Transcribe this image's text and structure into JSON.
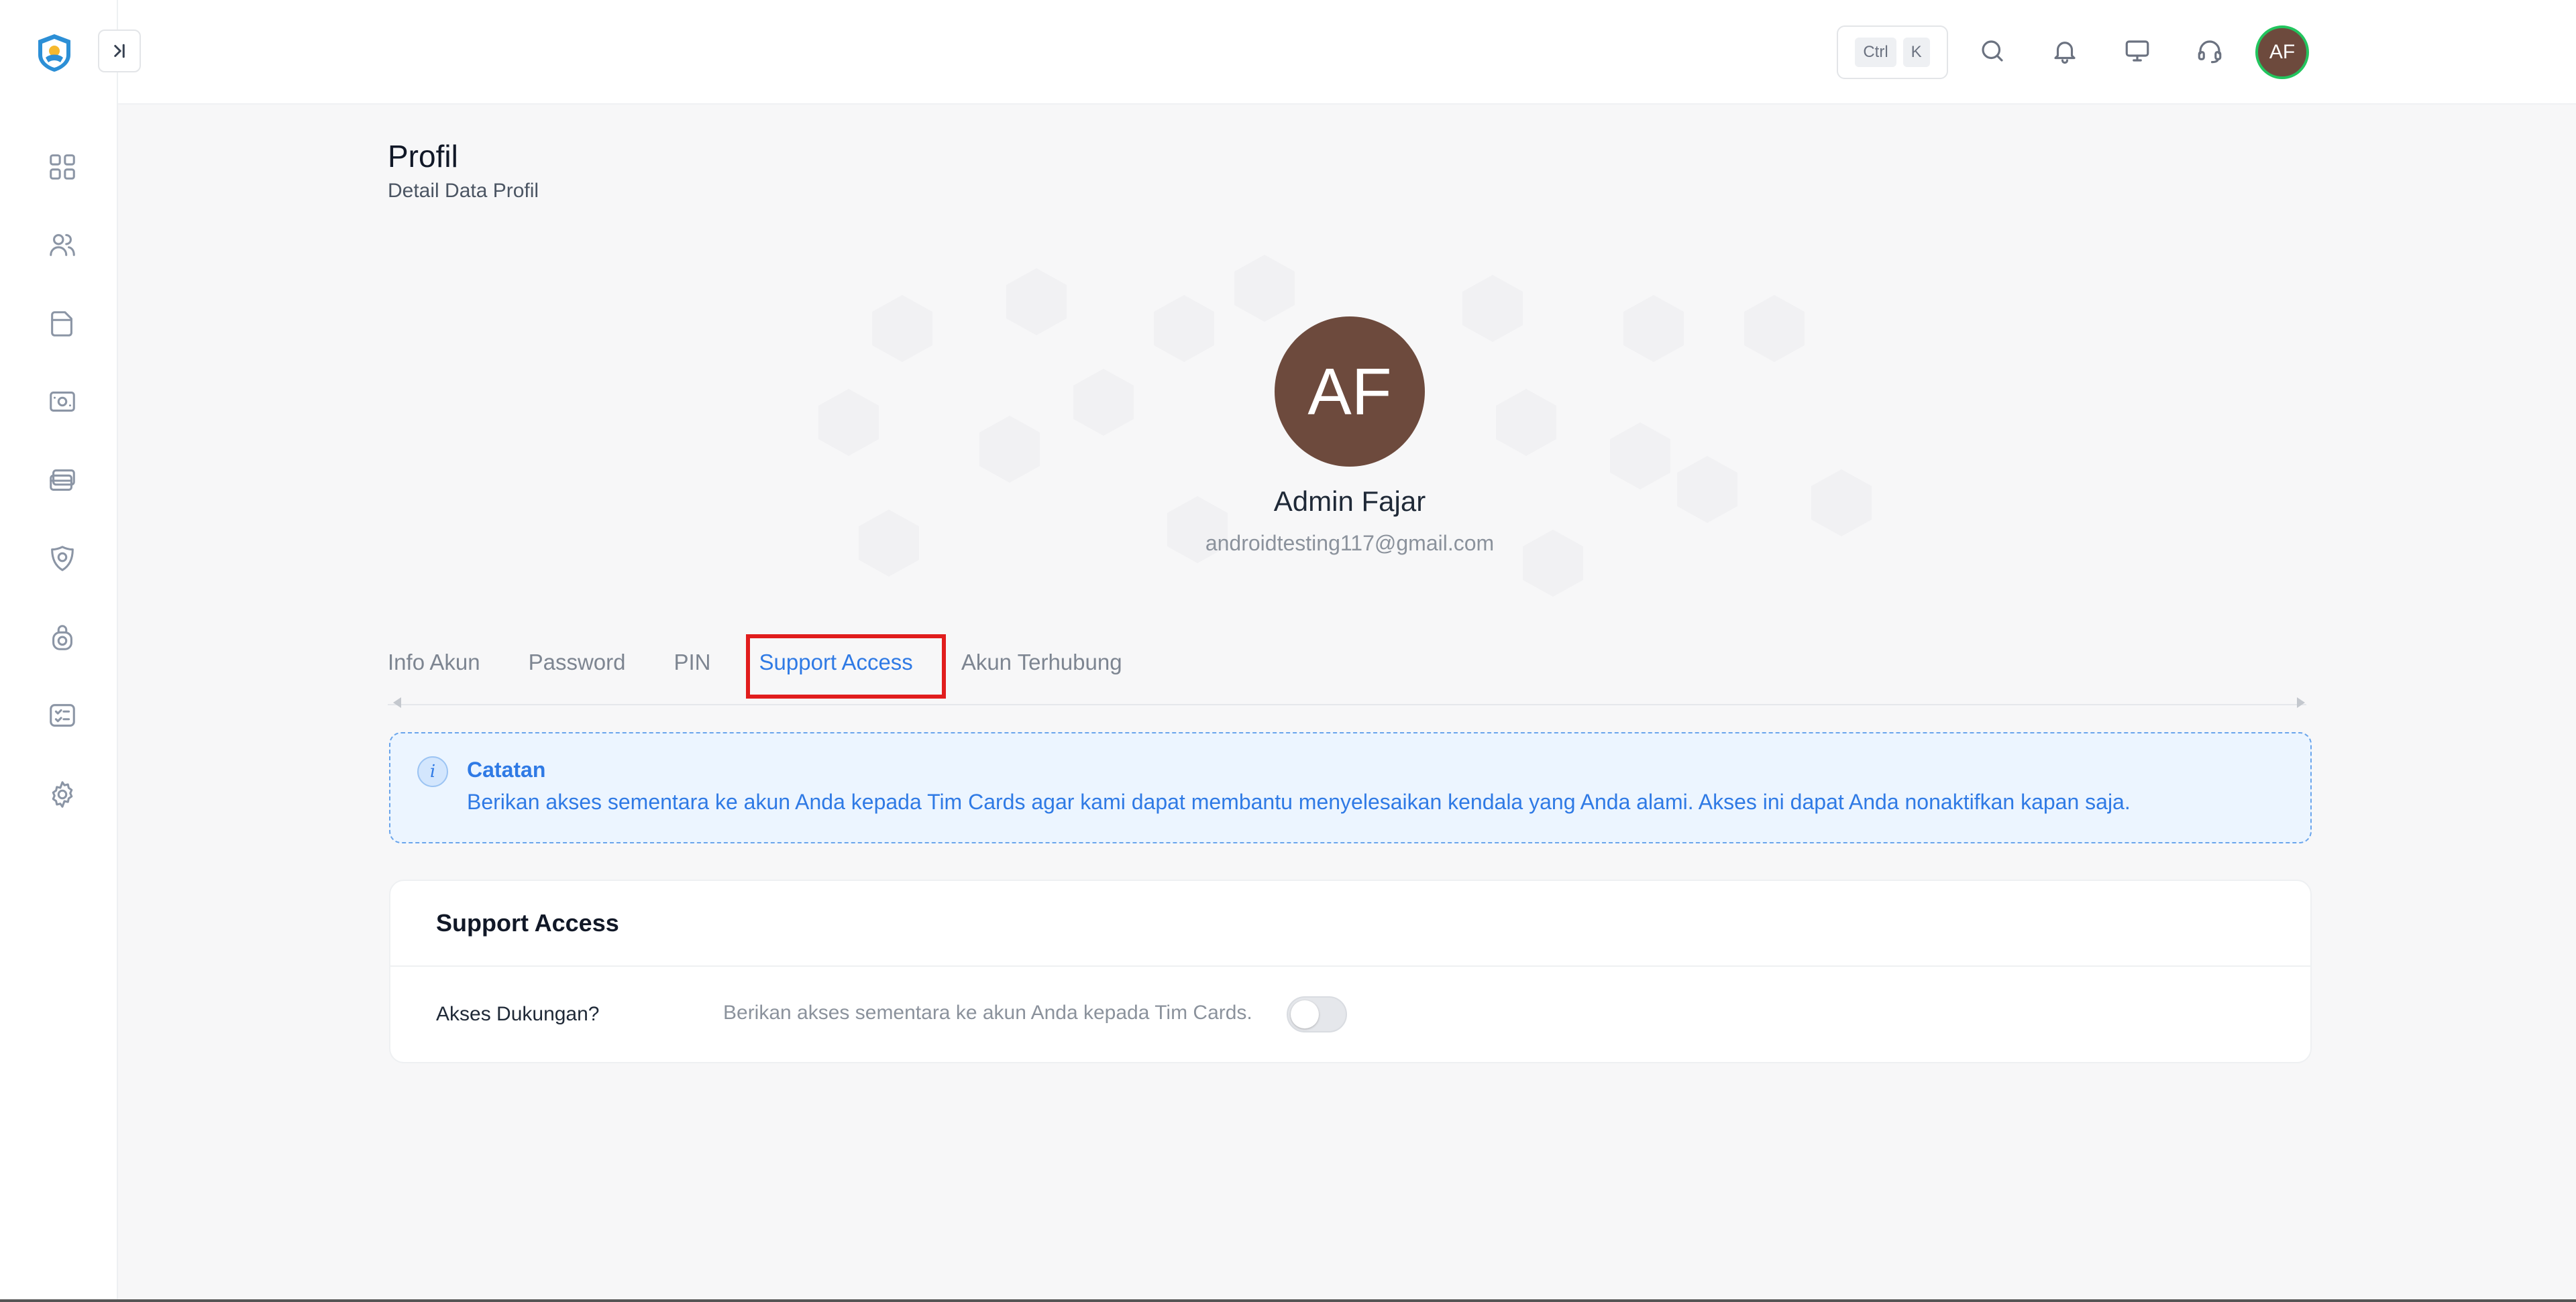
{
  "topbar": {
    "kbd_ctrl": "Ctrl",
    "kbd_k": "K",
    "avatar_initials": "AF"
  },
  "sidebar": {
    "items": [
      {
        "icon": "dashboard-grid-icon"
      },
      {
        "icon": "users-icon"
      },
      {
        "icon": "folder-icon"
      },
      {
        "icon": "cash-icon"
      },
      {
        "icon": "cards-icon"
      },
      {
        "icon": "badge-icon"
      },
      {
        "icon": "lock-camera-icon"
      },
      {
        "icon": "checklist-icon"
      },
      {
        "icon": "settings-gear-icon"
      }
    ]
  },
  "page": {
    "title": "Profil",
    "subtitle": "Detail Data Profil"
  },
  "profile": {
    "initials": "AF",
    "name": "Admin Fajar",
    "email": "androidtesting117@gmail.com",
    "avatar_color": "#6d4a3d"
  },
  "tabs": [
    {
      "label": "Info Akun",
      "active": false
    },
    {
      "label": "Password",
      "active": false
    },
    {
      "label": "PIN",
      "active": false
    },
    {
      "label": "Support Access",
      "active": true
    },
    {
      "label": "Akun Terhubung",
      "active": false
    }
  ],
  "note": {
    "icon_glyph": "i",
    "title": "Catatan",
    "text": "Berikan akses sementara ke akun Anda kepada Tim Cards agar kami dapat membantu menyelesaikan kendala yang Anda alami. Akses ini dapat Anda nonaktifkan kapan saja."
  },
  "support_card": {
    "title": "Support Access",
    "row_label": "Akses Dukungan?",
    "row_description": "Berikan akses sementara ke akun Anda kepada Tim Cards.",
    "toggle_on": false
  },
  "colors": {
    "accent": "#2f7ae5",
    "highlight": "#e11d1d",
    "online": "#22c55e"
  }
}
